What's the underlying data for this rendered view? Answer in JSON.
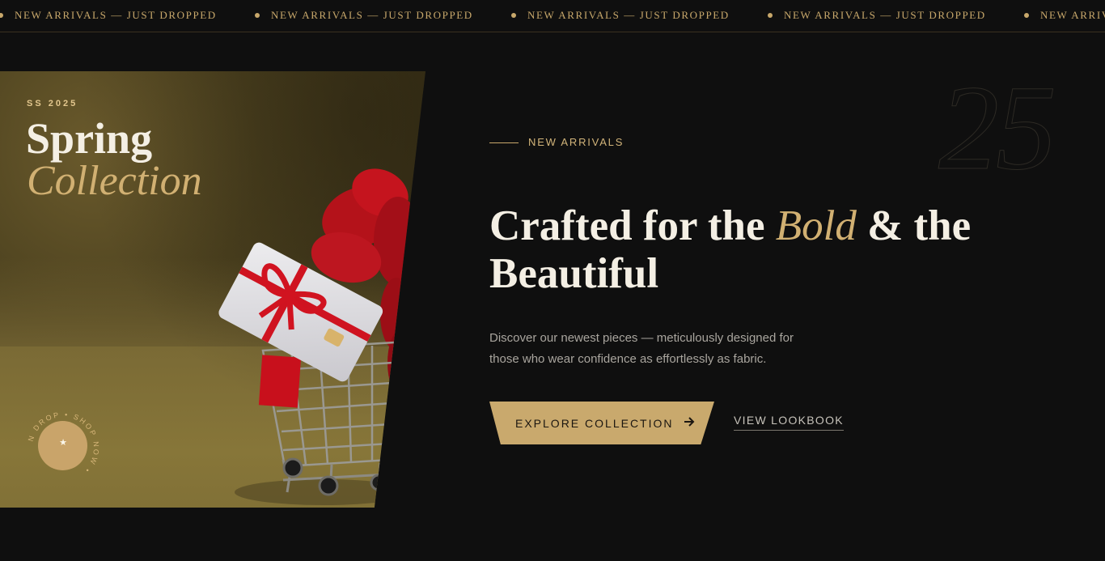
{
  "ticker": {
    "items": [
      "NEW ARRIVALS — JUST DROPPED",
      "NEW ARRIVALS — JUST DROPPED",
      "NEW ARRIVALS — JUST DROPPED",
      "NEW ARRIVALS — JUST DROPPED",
      "NEW ARRIVALS — JUST DROPPED"
    ]
  },
  "hero_image": {
    "season": "SS 2025",
    "title_line1": "Spring",
    "title_line2": "Collection",
    "badge_text": "N DROP • SHOP NOW •",
    "badge_icon": "star-icon"
  },
  "content": {
    "big_number": "25",
    "eyebrow": "NEW ARRIVALS",
    "headline_part1": "Crafted for the ",
    "headline_accent": "Bold",
    "headline_part2": " & the Beautiful",
    "description": "Discover our newest pieces — meticulously designed for those who wear confidence as effortlessly as fabric.",
    "primary_button": "EXPLORE COLLECTION",
    "primary_button_icon": "arrow-right-icon",
    "secondary_button": "VIEW LOOKBOOK"
  },
  "colors": {
    "background": "#0f0f0f",
    "accent_gold": "#c9a96d",
    "text_light": "#f4efe4",
    "text_muted": "#a9a59e"
  }
}
